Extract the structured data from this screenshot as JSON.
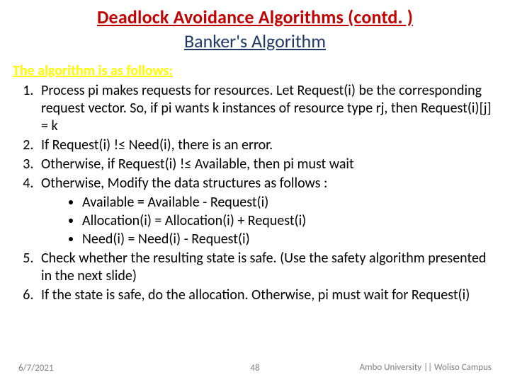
{
  "title": {
    "line1": "Deadlock Avoidance Algorithms (contd. )",
    "line2": "Banker's Algorithm"
  },
  "intro": "The algorithm is as follows:",
  "steps": [
    "Process pi makes requests for resources. Let Request(i) be the corresponding request vector. So, if pi wants k instances of resource type rj, then Request(i)[j] = k",
    "If Request(i) !≤ Need(i), there is an error.",
    "Otherwise, if Request(i) !≤ Available, then pi must wait",
    "Otherwise, Modify the data structures as follows :",
    "Check whether the resulting state is safe. (Use the safety algorithm presented in the next slide)",
    "If the state is safe, do the allocation. Otherwise, pi must wait for Request(i)"
  ],
  "substeps": [
    "Available = Available - Request(i)",
    "Allocation(i) = Allocation(i) + Request(i)",
    "Need(i) = Need(i) - Request(i)"
  ],
  "footer": {
    "date": "6/7/2021",
    "page": "48",
    "org": "Ambo University || Woliso Campus"
  }
}
